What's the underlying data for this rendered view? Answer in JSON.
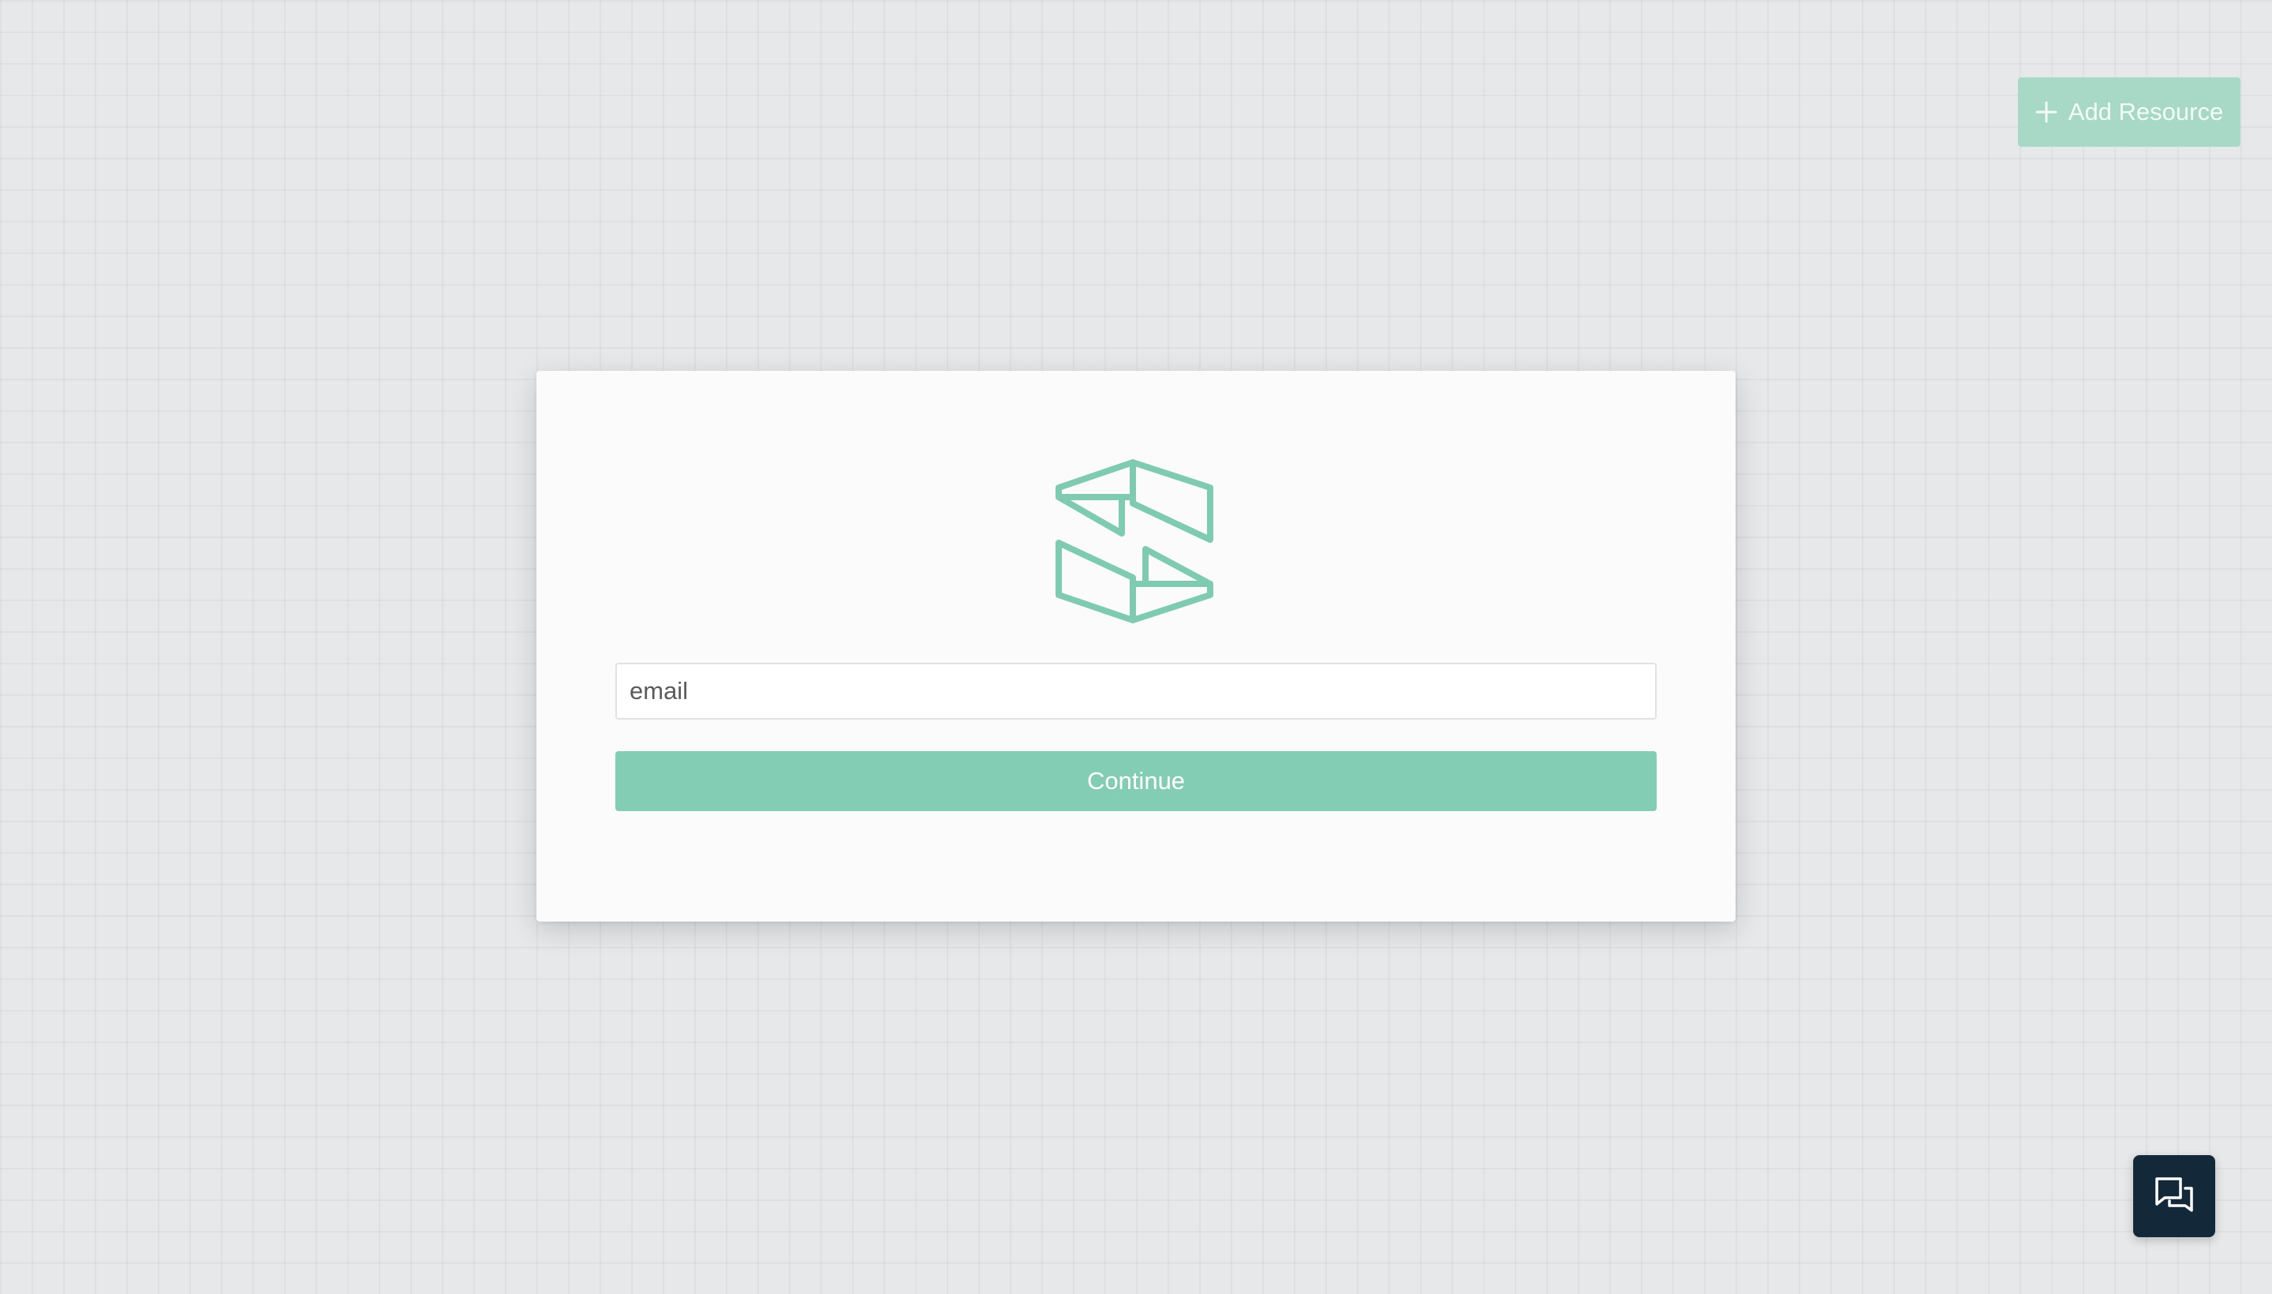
{
  "header": {
    "add_resource_label": "Add Resource",
    "add_resource_icon": "plus-icon"
  },
  "login": {
    "logo_icon": "brand-logo-icon",
    "email": {
      "placeholder": "email",
      "value": ""
    },
    "continue_label": "Continue"
  },
  "chat": {
    "icon": "chat-bubbles-icon"
  },
  "colors": {
    "accent": "#84cdb5",
    "accent_muted": "#a8d8c6",
    "logo_stroke": "#7ecbb1",
    "chat_bg": "#13293a",
    "page_bg": "#e7e8ea",
    "card_bg": "#fbfbfb"
  }
}
